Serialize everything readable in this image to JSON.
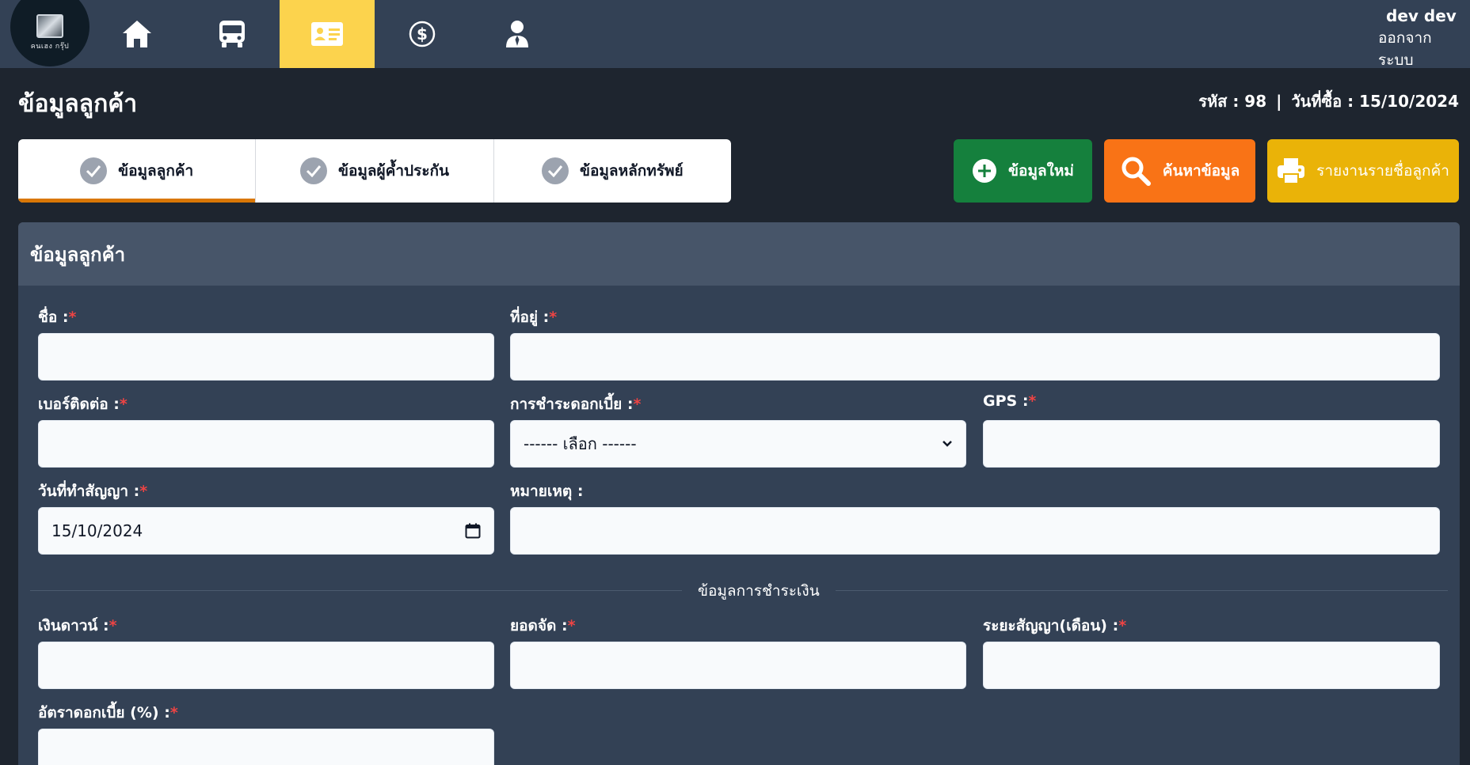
{
  "app": {
    "logo_text": "คนเฮง กรุ๊ป",
    "accent_color": "#fcd34d"
  },
  "nav": {
    "items": [
      {
        "icon": "home-icon"
      },
      {
        "icon": "bus-icon"
      },
      {
        "icon": "id-card-icon",
        "active": true
      },
      {
        "icon": "dollar-icon"
      },
      {
        "icon": "user-tie-icon"
      }
    ]
  },
  "user": {
    "name": "dev dev",
    "logout": "ออกจากระบบ"
  },
  "page": {
    "title": "ข้อมูลลูกค้า",
    "code_label": "รหัส : 98",
    "separator": "|",
    "date_label": "วันที่ซื้อ : 15/10/2024"
  },
  "tabs": [
    {
      "label": "ข้อมูลลูกค้า",
      "active": true
    },
    {
      "label": "ข้อมูลผู้ค้ำประกัน",
      "active": false
    },
    {
      "label": "ข้อมูลหลักทรัพย์",
      "active": false
    }
  ],
  "actions": {
    "new": "ข้อมูลใหม่",
    "search": "ค้นหาข้อมูล",
    "report": "รายงานรายชื่อลูกค้า",
    "colors": {
      "new": "#15803d",
      "search": "#f97316",
      "report": "#eab308"
    }
  },
  "form": {
    "title": "ข้อมูลลูกค้า",
    "required_mark": "*",
    "fields": {
      "name": {
        "label": "ชื่อ :",
        "value": ""
      },
      "address": {
        "label": "ที่อยู่ :",
        "value": ""
      },
      "phone": {
        "label": "เบอร์ติดต่อ :",
        "value": ""
      },
      "interest_payment": {
        "label": "การชำระดอกเบี้ย :",
        "value": "------ เลือก ------"
      },
      "gps": {
        "label": "GPS :",
        "value": ""
      },
      "contract_date": {
        "label": "วันที่ทำสัญญา :",
        "value": "15/10/2024"
      },
      "note": {
        "label": "หมายเหตุ :",
        "value": ""
      },
      "down_payment": {
        "label": "เงินดาวน์ :",
        "value": ""
      },
      "financed_amount": {
        "label": "ยอดจัด :",
        "value": ""
      },
      "term_months": {
        "label": "ระยะสัญญา(เดือน) :",
        "value": ""
      },
      "interest_rate": {
        "label": "อัตราดอกเบี้ย (%) :",
        "value": ""
      }
    },
    "payment_section": "ข้อมูลการชำระเงิน"
  }
}
